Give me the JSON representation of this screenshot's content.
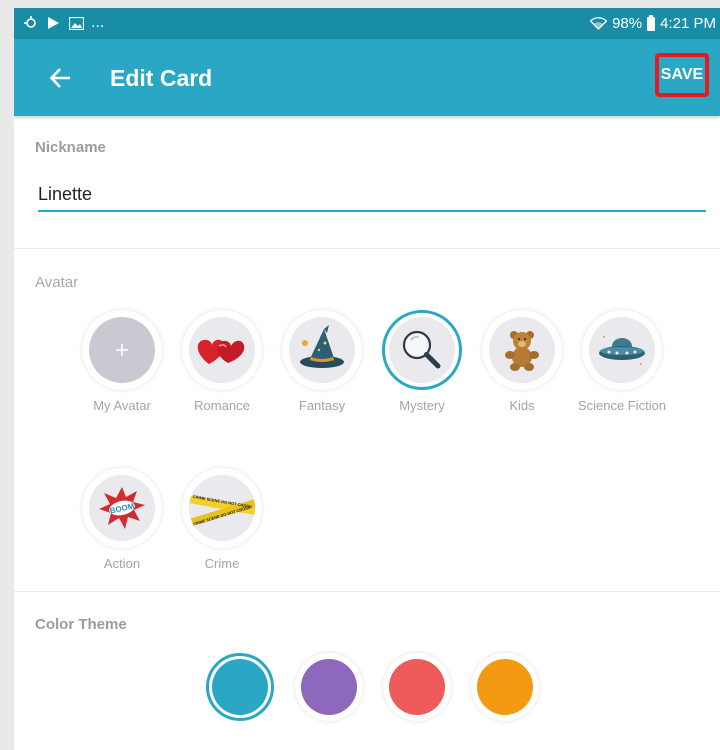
{
  "status_bar": {
    "battery": "98%",
    "time": "4:21 PM",
    "overflow": "..."
  },
  "app_bar": {
    "title": "Edit Card",
    "save_label": "SAVE",
    "back_icon": "arrow-left-icon"
  },
  "nickname": {
    "label": "Nickname",
    "value": "Linette"
  },
  "avatar": {
    "label": "Avatar",
    "items": [
      {
        "caption": "My Avatar",
        "icon": "plus-icon"
      },
      {
        "caption": "Romance",
        "icon": "hearts-icon"
      },
      {
        "caption": "Fantasy",
        "icon": "wizard-hat-icon"
      },
      {
        "caption": "Mystery",
        "icon": "magnifying-glass-icon",
        "selected": true
      },
      {
        "caption": "Kids",
        "icon": "teddy-bear-icon"
      },
      {
        "caption": "Science Fiction",
        "icon": "ufo-icon"
      },
      {
        "caption": "Action",
        "icon": "boom-icon",
        "art_text": "BOOM"
      },
      {
        "caption": "Crime",
        "icon": "crime-tape-icon",
        "art_text": "CRIME SCENE DO NOT CROSS"
      }
    ]
  },
  "color_theme": {
    "label": "Color Theme",
    "colors": [
      "#2aa7c4",
      "#8e68bd",
      "#ef5a5a",
      "#f39a12"
    ],
    "selected_index": 0
  },
  "colors": {
    "app_bar": "#29a7c4",
    "status_bar": "#198da6",
    "highlight_box": "#e41b23"
  }
}
